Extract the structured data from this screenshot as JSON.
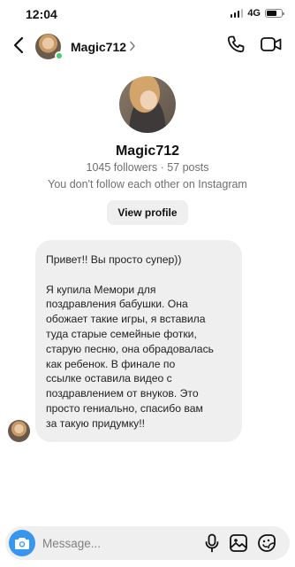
{
  "status_bar": {
    "time": "12:04",
    "network": "4G",
    "signal_bars": 4,
    "signal_strength": 3,
    "battery_level": 0.7
  },
  "header": {
    "username": "Magic712",
    "online": true,
    "icons": [
      "back-icon",
      "chevron-right-icon",
      "phone-icon",
      "video-camera-icon"
    ]
  },
  "profile": {
    "name": "Magic712",
    "stats": "1045 followers · 57 posts",
    "note": "You don't follow each other on Instagram",
    "view_profile_label": "View profile"
  },
  "message": {
    "greeting": "Привет!! Вы просто супер))",
    "body": "Я купила Мемори для\nпоздравления бабушки. Она\nобожает такие игры, я вставила\nтуда старые семейные фотки,\nстарую песню, она обрадовалась\nкак ребенок. В финале по\nссылке оставила видео с\nпоздравлением от внуков. Это\nпросто гениально, спасибо вам\nза такую придумку!!"
  },
  "composer": {
    "placeholder": "Message...",
    "icons": [
      "camera-icon",
      "microphone-icon",
      "gallery-icon",
      "sticker-icon"
    ]
  },
  "colors": {
    "accent": "#3797f0",
    "online": "#3bd16f",
    "bubble": "#efefef",
    "muted_text": "#6f6f6f"
  }
}
